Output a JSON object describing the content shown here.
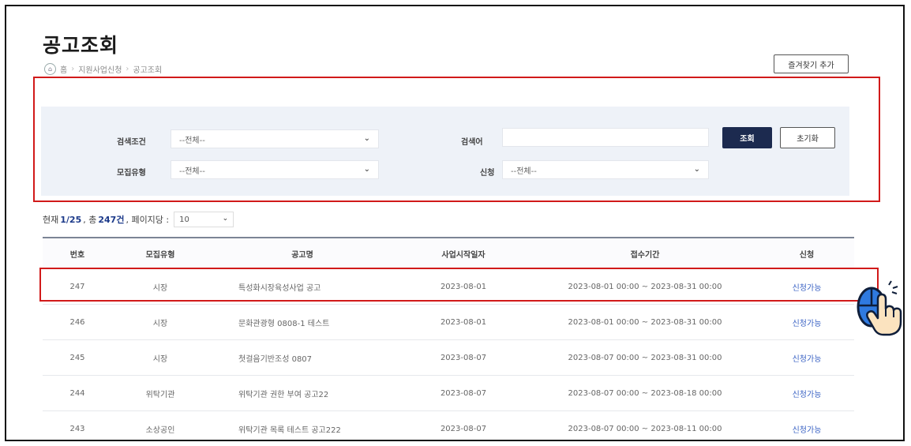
{
  "page": {
    "title": "공고조회",
    "favorite_button": "즐겨찾기 추가"
  },
  "breadcrumb": [
    "홈",
    "지원사업신청",
    "공고조회"
  ],
  "search": {
    "condition_label": "검색조건",
    "condition_value": "--전체--",
    "keyword_label": "검색어",
    "keyword_value": "",
    "type_label": "모집유형",
    "type_value": "--전체--",
    "apply_label": "신청",
    "apply_value": "--전체--",
    "search_button": "조회",
    "reset_button": "초기화"
  },
  "summary": {
    "prefix": "현재",
    "page": "1/25",
    "total_prefix": ", 총",
    "total": "247건",
    "per_page_label": ", 페이지당 :",
    "per_page_value": "10"
  },
  "table": {
    "headers": [
      "번호",
      "모집유형",
      "공고명",
      "사업시작일자",
      "접수기간",
      "신청"
    ],
    "rows": [
      {
        "no": "247",
        "type": "시장",
        "name": "특성화시장육성사업 공고",
        "start": "2023-08-01",
        "period": "2023-08-01 00:00 ~ 2023-08-31 00:00",
        "status": "신청가능"
      },
      {
        "no": "246",
        "type": "시장",
        "name": "문화관광형 0808-1 테스트",
        "start": "2023-08-01",
        "period": "2023-08-01 00:00 ~ 2023-08-31 00:00",
        "status": "신청가능"
      },
      {
        "no": "245",
        "type": "시장",
        "name": "첫걸음기반조성 0807",
        "start": "2023-08-07",
        "period": "2023-08-07 00:00 ~ 2023-08-31 00:00",
        "status": "신청가능"
      },
      {
        "no": "244",
        "type": "위탁기관",
        "name": "위탁기관 권한 부여 공고22",
        "start": "2023-08-07",
        "period": "2023-08-07 00:00 ~ 2023-08-18 00:00",
        "status": "신청가능"
      },
      {
        "no": "243",
        "type": "소상공인",
        "name": "위탁기관 목록 테스트 공고222",
        "start": "2023-08-07",
        "period": "2023-08-07 00:00 ~ 2023-08-11 00:00",
        "status": "신청가능"
      }
    ]
  },
  "colors": {
    "highlight": "#d11a1a",
    "primary_button": "#1c2a4f",
    "status_link": "#3b63c4",
    "panel_bg": "#eef2f8"
  },
  "icons": {
    "cursor": "click-hand-mouse-icon",
    "home": "home-icon",
    "dropdown": "chevron-down-icon"
  }
}
